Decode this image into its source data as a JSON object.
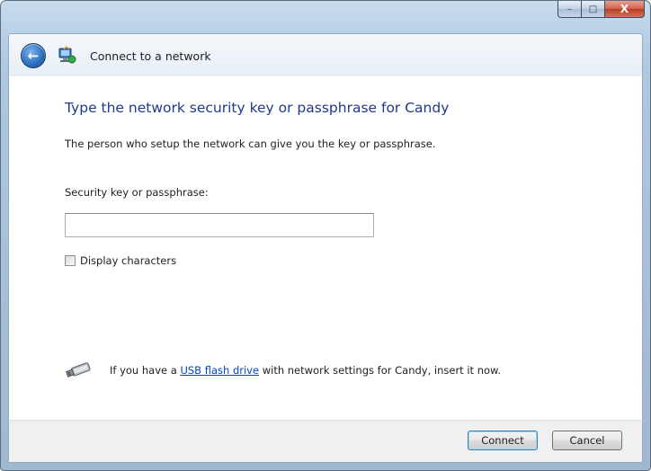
{
  "window": {
    "controls": {
      "minimize": "–",
      "maximize": "□",
      "close": "X"
    }
  },
  "nav": {
    "back_icon": "back-arrow-icon",
    "network_icon": "network-icon",
    "title": "Connect to a network"
  },
  "main": {
    "heading": "Type the network security key or passphrase for Candy",
    "subtitle": "The person who setup the network can give you the key or passphrase.",
    "field_label": "Security key or passphrase:",
    "key_value": "",
    "checkbox_label": "Display characters",
    "checkbox_checked": false,
    "usb": {
      "icon": "usb-drive-icon",
      "prefix": "If you have a ",
      "link": "USB flash drive",
      "suffix": " with network settings for Candy, insert it now."
    }
  },
  "footer": {
    "connect_label": "Connect",
    "cancel_label": "Cancel"
  },
  "colors": {
    "heading": "#1e3a8c",
    "link": "#0044cc",
    "frame": "#b8d0e6"
  }
}
